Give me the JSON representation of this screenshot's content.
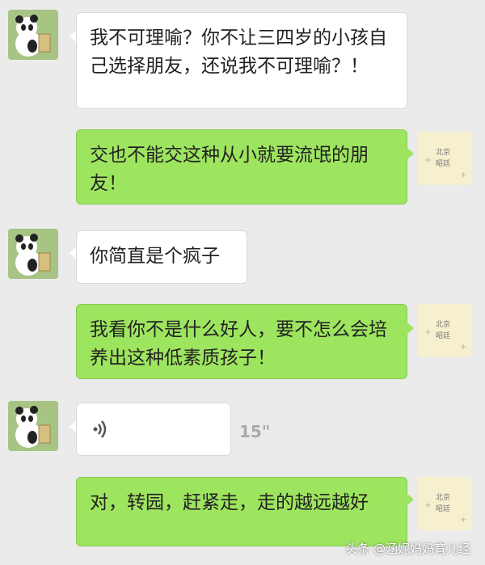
{
  "messages": [
    {
      "side": "left",
      "text": "我不可理喻？你不让三四岁的小孩自己选择朋友，还说我不可理喻？！"
    },
    {
      "side": "right",
      "text": "交也不能交这种从小就要流氓的朋友！"
    },
    {
      "side": "left",
      "text": "你简直是个疯子"
    },
    {
      "side": "right",
      "text": "我看你不是什么好人，要不怎么会培养出这种低素质孩子！"
    },
    {
      "side": "left",
      "type": "voice",
      "duration": "15\""
    },
    {
      "side": "right",
      "text": "对，转园，赶紧走，走的越远越好"
    }
  ],
  "right_avatar_text": [
    "北京",
    "昭廷"
  ],
  "watermark": "头条 @涵妮妈妈育儿经",
  "colors": {
    "outgoing": "#9ee55f",
    "incoming": "#ffffff",
    "background": "#ebebeb"
  },
  "icons": {
    "left_avatar": "panda-avatar-icon",
    "right_avatar": "sticky-note-avatar-icon",
    "voice": "voice-waves-icon"
  }
}
